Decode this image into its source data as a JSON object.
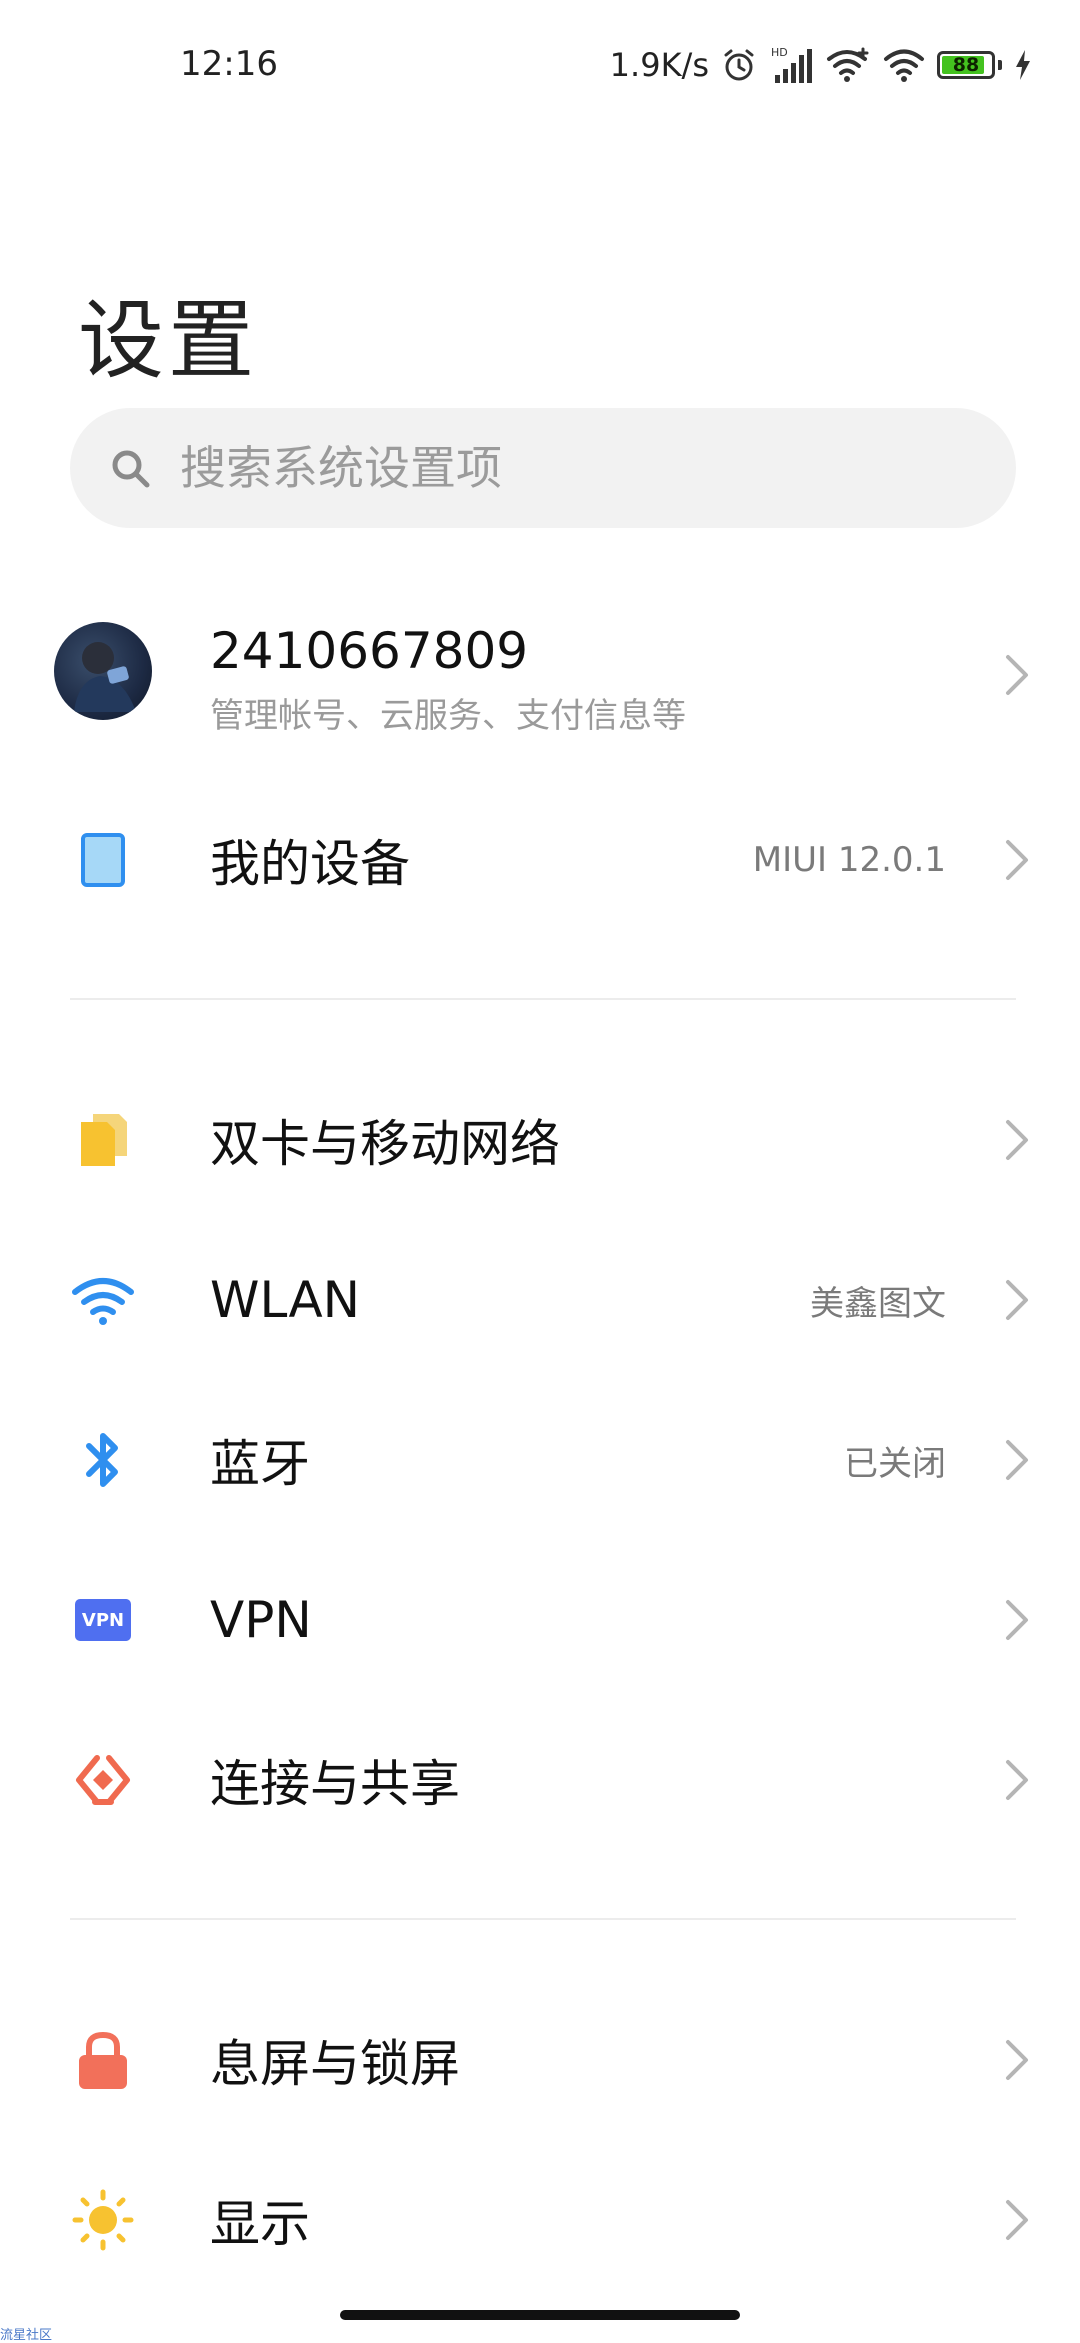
{
  "status_bar": {
    "time": "12:16",
    "net_speed": "1.9K/s",
    "hd_label": "HD",
    "battery_level": "88",
    "battery_fraction": 0.88,
    "icons": [
      "alarm-icon",
      "signal-icon",
      "wifi-plus-icon",
      "wifi-icon",
      "battery-icon",
      "charging-icon"
    ]
  },
  "page": {
    "title": "设置"
  },
  "search": {
    "placeholder": "搜索系统设置项"
  },
  "account": {
    "id": "2410667809",
    "subtitle": "管理帐号、云服务、支付信息等"
  },
  "my_device": {
    "label": "我的设备",
    "value": "MIUI 12.0.1"
  },
  "network_items": [
    {
      "label": "双卡与移动网络",
      "value": "",
      "icon": "sim-card-icon",
      "color": "#f7c230"
    },
    {
      "label": "WLAN",
      "value": "美鑫图文",
      "icon": "wifi-icon",
      "color": "#2f8fef"
    },
    {
      "label": "蓝牙",
      "value": "已关闭",
      "icon": "bluetooth-icon",
      "color": "#2f8fef"
    },
    {
      "label": "VPN",
      "value": "",
      "icon": "vpn-icon",
      "color": "#4f6ff0",
      "badge": "VPN"
    },
    {
      "label": "连接与共享",
      "value": "",
      "icon": "share-icon",
      "color": "#f06a4f"
    }
  ],
  "display_items": [
    {
      "label": "息屏与锁屏",
      "value": "",
      "icon": "lock-icon",
      "color": "#f2705a"
    },
    {
      "label": "显示",
      "value": "",
      "icon": "brightness-icon",
      "color": "#f7c230"
    }
  ],
  "watermark": "流星社区"
}
